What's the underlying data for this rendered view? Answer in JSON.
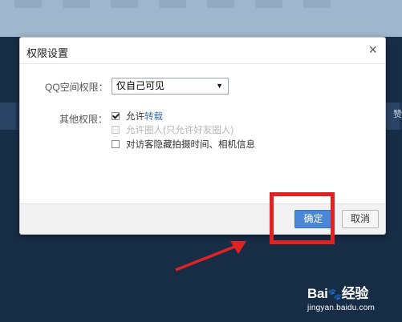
{
  "dialog": {
    "title": "权限设置",
    "close_icon": "close-icon",
    "qzone_label": "QQ空间权限：",
    "qzone_select_value": "仅自己可见",
    "other_label": "其他权限：",
    "options": [
      {
        "prefix": "允许",
        "link": "转载",
        "checked": true,
        "disabled": false
      },
      {
        "text": "允许圈人(只允许好友圈人)",
        "checked": false,
        "disabled": true
      },
      {
        "text": "对访客隐藏拍摄时间、相机信息",
        "checked": false,
        "disabled": false
      }
    ],
    "ok_label": "确定",
    "cancel_label": "取消"
  },
  "background": {
    "side_char": "赞"
  },
  "watermark": {
    "brand": "Bai",
    "brand_suffix": "经验",
    "url": "jingyan.baidu.com"
  },
  "colors": {
    "accent": "#4a87d6",
    "highlight": "#e12222",
    "page_bg": "#172c45",
    "top_band": "#9fb7cc"
  }
}
